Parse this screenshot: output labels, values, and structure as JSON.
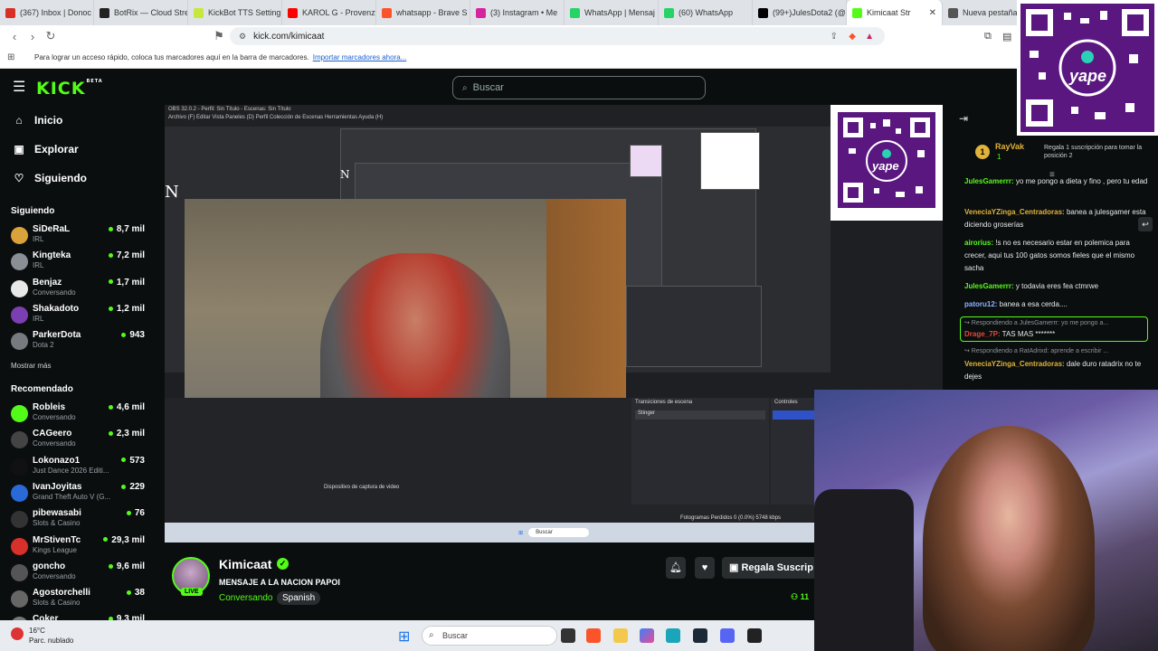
{
  "browser": {
    "tabs": [
      {
        "label": "(367) Inbox | Donoc",
        "color": "#d93025"
      },
      {
        "label": "BotRix — Cloud Stre",
        "color": "#222222"
      },
      {
        "label": "KickBot TTS Setting",
        "color": "#c6e83a"
      },
      {
        "label": "KAROL G - Provenz",
        "color": "#ff0000"
      },
      {
        "label": "whatsapp - Brave S",
        "color": "#fb542b"
      },
      {
        "label": "(3) Instagram • Me",
        "color": "#d6249f"
      },
      {
        "label": "WhatsApp | Mensaj",
        "color": "#25d366"
      },
      {
        "label": "(60) WhatsApp",
        "color": "#25d366"
      },
      {
        "label": "(99+)JulesDota2 (@",
        "color": "#000000"
      },
      {
        "label": "Kimicaat Str",
        "color": "#53fc18",
        "active": true
      },
      {
        "label": "Nueva pestaña",
        "color": "#555555"
      }
    ],
    "url": "kick.com/kimicaat",
    "bookmarks_text": "Para lograr un acceso rápido, coloca tus marcadores aquí en la barra de marcadores.",
    "bookmarks_link": "Importar marcadores ahora..."
  },
  "kick": {
    "logo": "KICK",
    "logo_sup": "BETA",
    "search_placeholder": "Buscar",
    "nav": [
      {
        "label": "Inicio",
        "icon": "home-icon",
        "glyph": "⌂"
      },
      {
        "label": "Explorar",
        "icon": "compass-icon",
        "glyph": "▣"
      },
      {
        "label": "Siguiendo",
        "icon": "heart-icon",
        "glyph": "♡"
      }
    ],
    "following_title": "Siguiendo",
    "following": [
      {
        "name": "SiDeRaL",
        "sub": "IRL",
        "count": "8,7 mil",
        "color": "#d9a23a"
      },
      {
        "name": "Kingteka",
        "sub": "IRL",
        "count": "7,2 mil",
        "color": "#8a8f96"
      },
      {
        "name": "Benjaz",
        "sub": "Conversando",
        "count": "1,7 mil",
        "color": "#e8e8e8"
      },
      {
        "name": "Shakadoto",
        "sub": "IRL",
        "count": "1,2 mil",
        "color": "#7a3fb0"
      },
      {
        "name": "ParkerDota",
        "sub": "Dota 2",
        "count": "943",
        "color": "#777b80"
      }
    ],
    "show_more": "Mostrar más",
    "recommended_title": "Recomendado",
    "recommended": [
      {
        "name": "Robleis",
        "sub": "Conversando",
        "count": "4,6 mil",
        "color": "#53fc18"
      },
      {
        "name": "CAGeero",
        "sub": "Conversando",
        "count": "2,3 mil",
        "color": "#444444"
      },
      {
        "name": "Lokonazo1",
        "sub": "Just Dance 2026 Editi...",
        "count": "573",
        "color": "#111111"
      },
      {
        "name": "IvanJoyitas",
        "sub": "Grand Theft Auto V (G...",
        "count": "229",
        "color": "#2a6ad8"
      },
      {
        "name": "pibewasabi",
        "sub": "Slots & Casino",
        "count": "76",
        "color": "#333333"
      },
      {
        "name": "MrStivenTc",
        "sub": "Kings League",
        "count": "29,3 mil",
        "color": "#d8302a"
      },
      {
        "name": "goncho",
        "sub": "Conversando",
        "count": "9,6 mil",
        "color": "#555555"
      },
      {
        "name": "Agostorchelli",
        "sub": "Slots & Casino",
        "count": "38",
        "color": "#666666"
      },
      {
        "name": "Coker",
        "sub": "",
        "count": "9,3 mil",
        "color": "#777777"
      }
    ]
  },
  "player": {
    "obs_title": "OBS 32.0.2 - Perfil: Sin Título - Escenas: Sin Título",
    "obs_menu": "Archivo (F)   Editar   Vista   Paneles (D)   Perfil   Colección de Escenas   Herramientas   Ayuda (H)",
    "n_letter": "N",
    "transitions_title": "Transiciones de escena",
    "transition_value": "Stinger",
    "controls_title": "Controles",
    "capture_label": "Dispositivo de captura de video",
    "stats": "Fotogramas Perdidos 0 (0.0%)   5748 kbps",
    "taskbar_search": "Buscar"
  },
  "stream": {
    "streamer": "Kimicaat",
    "live": "LIVE",
    "title": "MENSAJE A LA NACION PAPOI",
    "category": "Conversando",
    "language": "Spanish",
    "gift_sub": "Regala Suscrip",
    "viewers": "11"
  },
  "chat": {
    "pinned_user": "RayVak",
    "pinned_badge": "1",
    "pinned_count": "1",
    "pinned_msg": "Regala 1 suscripción para tomar la posición 2",
    "messages": [
      {
        "user": "JulesGamerrr:",
        "text": " yo me pongo a dieta y fino , pero tu edad",
        "color": "#53fc18"
      },
      {
        "user": "VeneciaYZinga_Centradoras:",
        "text": " banea a julesgamer esta diciendo groserías",
        "color": "#e0b33a"
      },
      {
        "user": "airorius:",
        "text": " !s no es necesario estar en polemica para crecer, aqui tus 100 gatos somos fieles que el mismo sacha",
        "color": "#53fc18"
      },
      {
        "user": "JulesGamerrr:",
        "text": " y todavia eres fea ctmrwe",
        "color": "#53fc18"
      },
      {
        "user": "patoru12:",
        "text": " banea a esa cerda....",
        "color": "#8fb2ff"
      }
    ],
    "reply1_ref": "↪ Respondiendo a JulesGamerrr: yo me pongo a...",
    "reply1_user": "Drage_7P:",
    "reply1_text": " TAS MAS *******",
    "reply1_color": "#e8473b",
    "reply2_ref": "↪ Respondiendo a RatAdrixd: aprende a escribir ...",
    "reply2_user": "VeneciaYZinga_Centradoras:",
    "reply2_text": " dale duro ratadrix no te dejes",
    "reply2_color": "#e0b33a"
  },
  "overlay": {
    "qr_brand": "yape"
  },
  "windows": {
    "temp": "16°C",
    "weather": "Parc. nublado",
    "search": "Buscar"
  }
}
